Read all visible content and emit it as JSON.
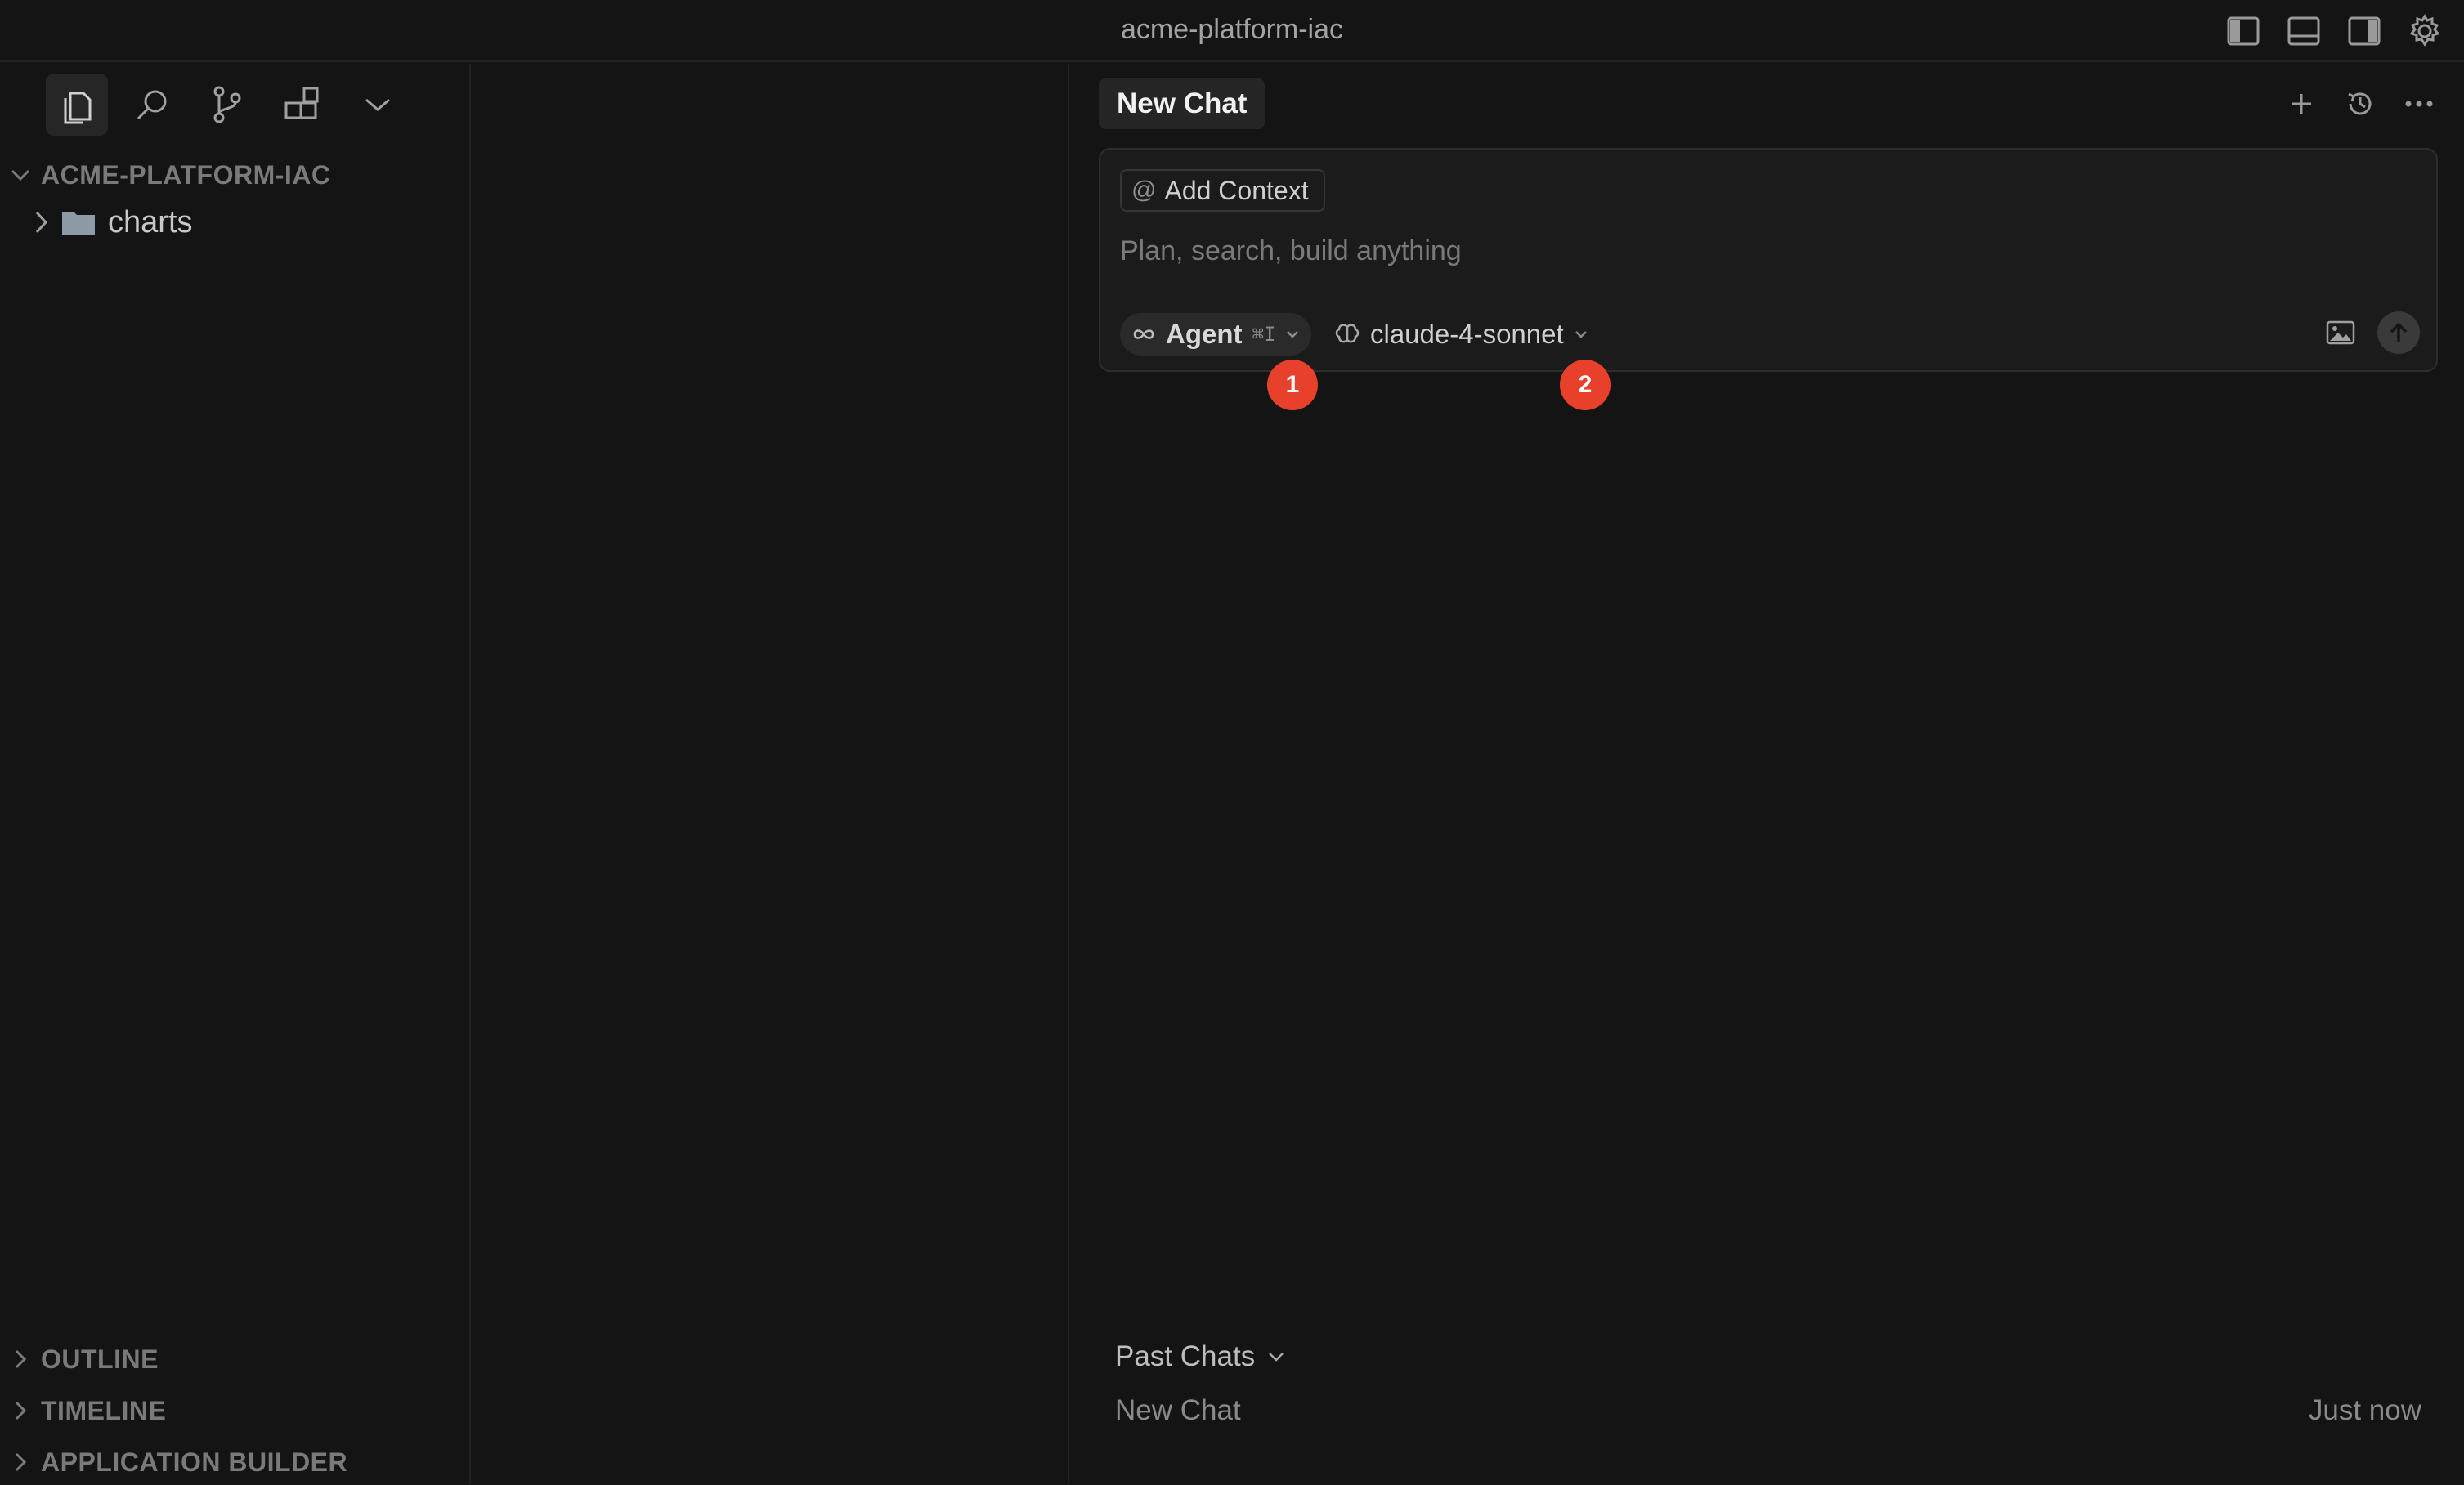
{
  "window": {
    "title": "acme-platform-iac"
  },
  "title_actions": [
    {
      "name": "toggle-primary-sidebar-icon"
    },
    {
      "name": "toggle-panel-icon"
    },
    {
      "name": "toggle-secondary-sidebar-icon"
    },
    {
      "name": "settings-gear-icon"
    }
  ],
  "sidebar": {
    "activity": [
      {
        "name": "explorer-icon",
        "active": true
      },
      {
        "name": "search-icon"
      },
      {
        "name": "source-control-icon"
      },
      {
        "name": "extensions-icon"
      },
      {
        "name": "more-views-chevron-icon"
      }
    ],
    "workspace": "ACME-PLATFORM-IAC",
    "tree": [
      {
        "label": "charts",
        "type": "folder",
        "expanded": false
      }
    ],
    "sections": {
      "outline": "OUTLINE",
      "timeline": "TIMELINE",
      "app_builder": "APPLICATION BUILDER"
    }
  },
  "chat": {
    "tab_label": "New Chat",
    "actions": [
      {
        "name": "new-chat-plus-icon"
      },
      {
        "name": "history-icon"
      },
      {
        "name": "more-ellipsis-icon"
      }
    ],
    "composer": {
      "context_label": "Add Context",
      "context_symbol": "@",
      "placeholder": "Plan, search, build anything",
      "value": "",
      "mode": {
        "label": "Agent",
        "shortcut": "⌘I",
        "icon": "infinity-icon"
      },
      "model": {
        "label": "claude-4-sonnet",
        "icon": "brain-icon"
      }
    },
    "badges": [
      "1",
      "2"
    ],
    "past_chats": {
      "label": "Past Chats",
      "items": [
        {
          "title": "New Chat",
          "time": "Just now"
        }
      ]
    }
  },
  "colors": {
    "background": "#141414",
    "badge": "#e8412b",
    "composer_bg": "#1b1b1b",
    "text_muted": "#7a7a7a"
  }
}
